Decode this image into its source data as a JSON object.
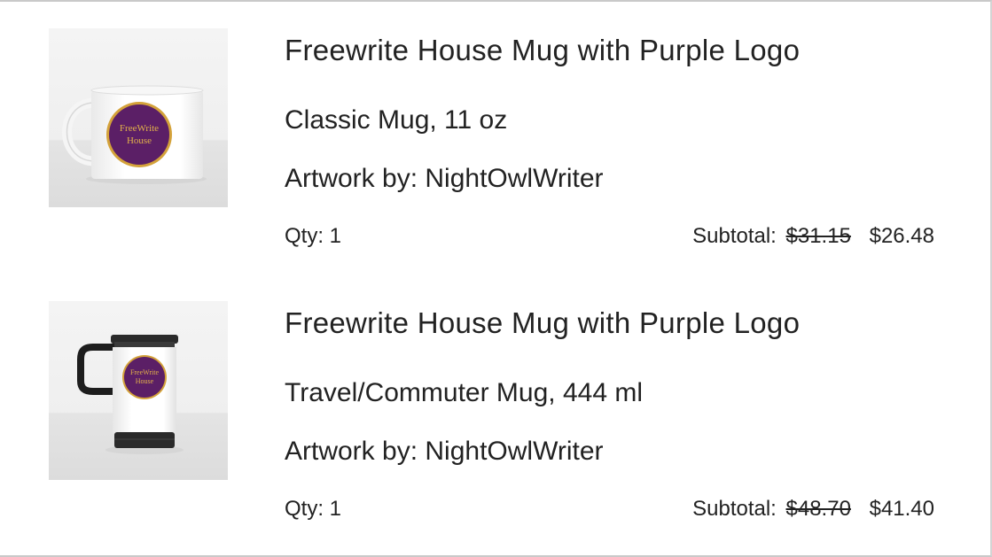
{
  "cart": {
    "items": [
      {
        "title": "Freewrite House Mug with Purple Logo",
        "variant": "Classic Mug, 11 oz",
        "artist": "Artwork by: NightOwlWriter",
        "qty": "Qty: 1",
        "subtotal_label": "Subtotal:",
        "original_price": "$31.15",
        "sale_price": "$26.48",
        "image": {
          "icon": "classic-mug-image",
          "logo_text": [
            "FreeWrite",
            "House"
          ],
          "logo_color": "#5b1f66",
          "rim_color": "#d4a23a"
        }
      },
      {
        "title": "Freewrite House Mug with Purple Logo",
        "variant": "Travel/Commuter Mug, 444 ml",
        "artist": "Artwork by: NightOwlWriter",
        "qty": "Qty: 1",
        "subtotal_label": "Subtotal:",
        "original_price": "$48.70",
        "sale_price": "$41.40",
        "image": {
          "icon": "travel-mug-image",
          "logo_text": [
            "FreeWrite",
            "House"
          ],
          "logo_color": "#5b1f66",
          "rim_color": "#d4a23a"
        }
      }
    ]
  }
}
